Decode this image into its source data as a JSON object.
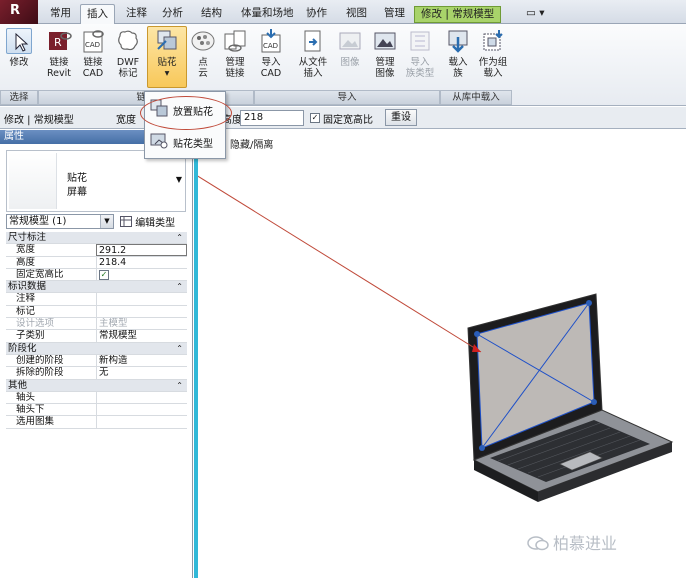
{
  "tabs": {
    "items": [
      "常用",
      "插入",
      "注释",
      "分析",
      "结构",
      "体量和场地",
      "协作",
      "视图",
      "管理"
    ],
    "active": "插入",
    "context": "修改 | 常规模型",
    "extra": "▭ ▾"
  },
  "ribbon": {
    "buttons": [
      {
        "icon": "cursor-icon",
        "label": "修改"
      },
      {
        "icon": "revit-link-icon",
        "label1": "链接",
        "label2": "Revit"
      },
      {
        "icon": "cad-link-icon",
        "label1": "链接",
        "label2": "CAD"
      },
      {
        "icon": "dwf-markup-icon",
        "label1": "DWF",
        "label2": "标记"
      },
      {
        "icon": "decal-icon",
        "label1": "贴花",
        "label2": "▾"
      },
      {
        "icon": "point-cloud-icon",
        "label1": "点",
        "label2": "云"
      },
      {
        "icon": "manage-links-icon",
        "label1": "管理",
        "label2": "链接"
      },
      {
        "icon": "import-cad-icon",
        "label1": "导入",
        "label2": "CAD"
      },
      {
        "icon": "insert-from-file-icon",
        "label1": "从文件",
        "label2": "插入"
      },
      {
        "icon": "image-icon",
        "label1": "图像",
        "label2": ""
      },
      {
        "icon": "manage-images-icon",
        "label1": "管理",
        "label2": "图像"
      },
      {
        "icon": "import-family-types-icon",
        "label1": "导入",
        "label2": "族类型"
      },
      {
        "icon": "load-family-icon",
        "label1": "载入",
        "label2": "族"
      },
      {
        "icon": "load-as-group-icon",
        "label1": "作为组",
        "label2": "载入"
      }
    ],
    "panels": [
      "选择",
      "链接",
      "导入",
      "从库中载入"
    ]
  },
  "dropdown": {
    "items": [
      {
        "icon": "place-decal-icon",
        "label": "放置贴花"
      },
      {
        "icon": "decal-types-icon",
        "label": "贴花类型"
      }
    ]
  },
  "options_bar": {
    "context": "修改 | 常规模型",
    "width_label": "宽度",
    "height_label": "高度",
    "height_value": "218",
    "lock_label": "固定宽高比",
    "lock_checked": true,
    "apply_label": "重设"
  },
  "properties": {
    "title": "属性",
    "preview_line1": "贴花",
    "preview_line2": "屏幕",
    "type_selector": "常规模型 (1)",
    "edit_type_label": "编辑类型",
    "sections": [
      {
        "name": "尺寸标注",
        "rows": [
          {
            "key": "宽度",
            "value": "291.2",
            "box": true
          },
          {
            "key": "高度",
            "value": "218.4"
          },
          {
            "key": "固定宽高比",
            "value": "✓",
            "check": true
          }
        ]
      },
      {
        "name": "标识数据",
        "rows": [
          {
            "key": "注释",
            "value": ""
          },
          {
            "key": "标记",
            "value": ""
          },
          {
            "key": "设计选项",
            "value": "主模型",
            "dim": true
          },
          {
            "key": "子类别",
            "value": "常规模型"
          }
        ]
      },
      {
        "name": "阶段化",
        "rows": [
          {
            "key": "创建的阶段",
            "value": "新构造"
          },
          {
            "key": "拆除的阶段",
            "value": "无"
          }
        ]
      },
      {
        "name": "其他",
        "rows": [
          {
            "key": "轴头",
            "value": ""
          },
          {
            "key": "轴头下",
            "value": ""
          },
          {
            "key": "选用图集",
            "value": ""
          }
        ]
      }
    ],
    "collapse_glyph": "⌃"
  },
  "view": {
    "title": "隐藏/隔离"
  },
  "watermark": "柏慕进业",
  "colors": {
    "accent": "#30b8d8",
    "context_tab": "#a8d36a",
    "highlight": "#f8c85a",
    "annotation": "#c04a3a"
  }
}
